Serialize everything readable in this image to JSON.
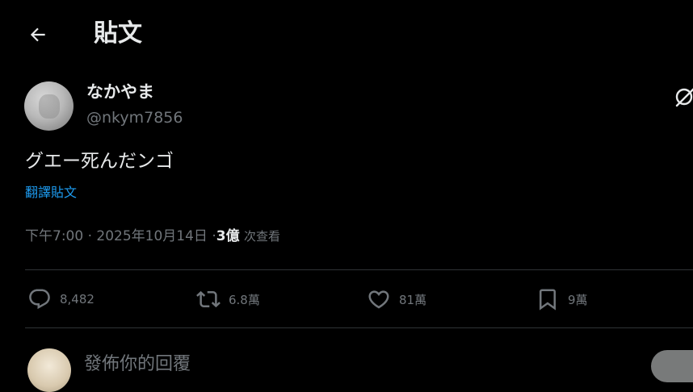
{
  "header": {
    "title": "貼文"
  },
  "post": {
    "display_name": "なかやま",
    "handle": "@nkym7856",
    "text": "グエー死んだンゴ",
    "translate_label": "翻譯貼文",
    "time": "下午7:00",
    "separator": "·",
    "date": "2025年10月14日",
    "views_count": "3億",
    "views_label": "次查看"
  },
  "actions": {
    "replies": "8,482",
    "reposts": "6.8萬",
    "likes": "81萬",
    "bookmarks": "9萬"
  },
  "reply_box": {
    "placeholder": "發佈你的回覆"
  },
  "icons": {
    "back": "arrow-left-icon",
    "grok": "grok-icon",
    "reply": "speech-bubble-icon",
    "repost": "repost-icon",
    "like": "heart-icon",
    "bookmark": "bookmark-icon"
  },
  "colors": {
    "background": "#000000",
    "text_primary": "#e7e9ea",
    "text_secondary": "#71767b",
    "link": "#1d9bf0",
    "divider": "#2f3336"
  }
}
